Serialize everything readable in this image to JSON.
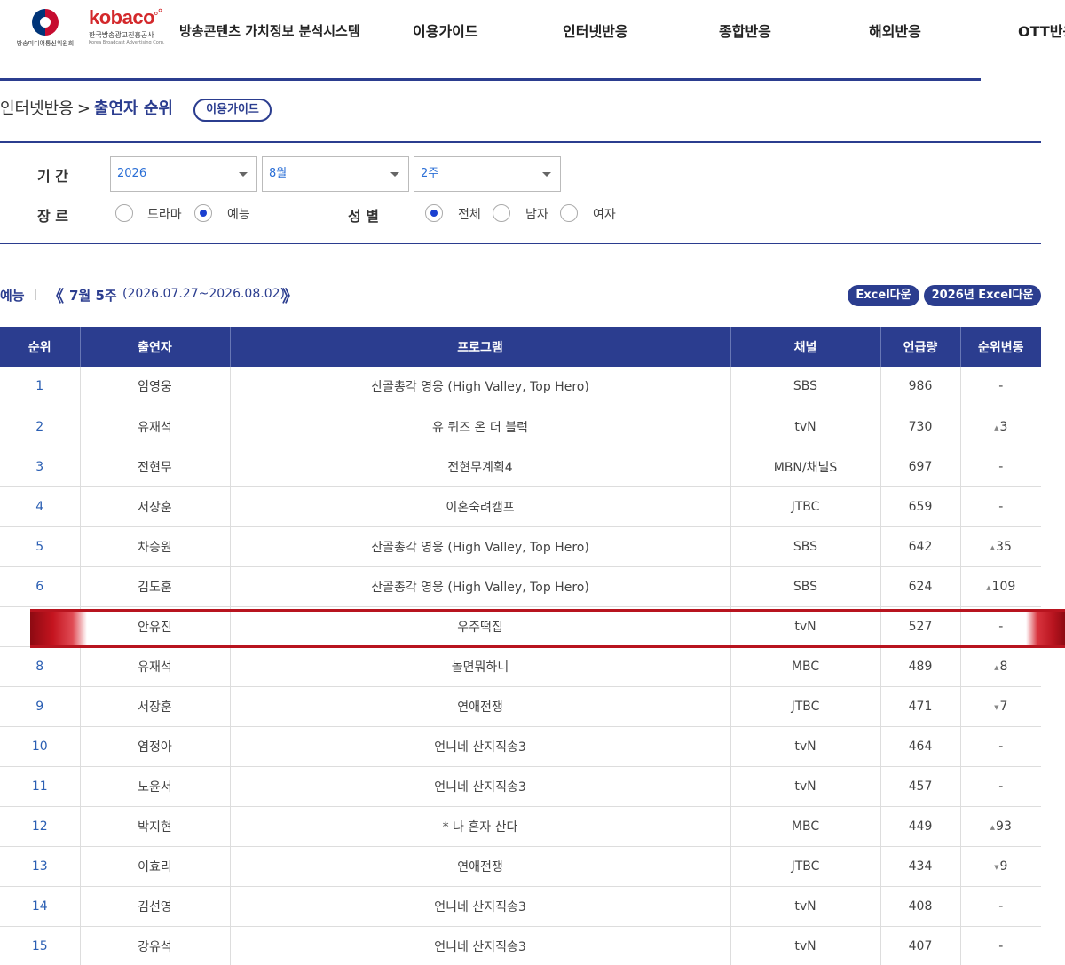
{
  "header": {
    "gov_logo_text": "방송미디어통신위원회",
    "kobaco_word": "kobaco",
    "kobaco_ko": "한국방송광고진흥공사",
    "kobaco_en": "Korea Broadcast Advertising Corp.",
    "site_title": "방송콘텐츠 가치정보 분석시스템",
    "nav": [
      "이용가이드",
      "인터넷반응",
      "종합반응",
      "해외반응",
      "OTT반응"
    ]
  },
  "breadcrumb": {
    "parent": "인터넷반응",
    "separator": ">",
    "current": "출연자 순위",
    "guide_button": "이용가이드"
  },
  "filters": {
    "period_label": "기 간",
    "year": "2026",
    "month": "8월",
    "week": "2주",
    "genre_label": "장 르",
    "genre_options": [
      {
        "label": "드라마",
        "selected": false
      },
      {
        "label": "예능",
        "selected": true
      }
    ],
    "gender_label": "성 별",
    "gender_options": [
      {
        "label": "전체",
        "selected": true
      },
      {
        "label": "남자",
        "selected": false
      },
      {
        "label": "여자",
        "selected": false
      }
    ]
  },
  "week_nav": {
    "genre": "예능",
    "prev_glyph": "《",
    "label": "7월 5주",
    "range": "(2026.07.27~2026.08.02)",
    "next_glyph": "》",
    "excel_button": "Excel다운",
    "excel_year_button": "2026년 Excel다운"
  },
  "table": {
    "columns": [
      "순위",
      "출연자",
      "프로그램",
      "채널",
      "언급량",
      "순위변동"
    ],
    "rows": [
      {
        "rank": "1",
        "name": "임영웅",
        "program": "산골총각 영웅 (High Valley, Top Hero)",
        "channel": "SBS",
        "mentions": "986",
        "change": "-",
        "dir": "none"
      },
      {
        "rank": "2",
        "name": "유재석",
        "program": "유 퀴즈 온 더 블럭",
        "channel": "tvN",
        "mentions": "730",
        "change": "3",
        "dir": "up"
      },
      {
        "rank": "3",
        "name": "전현무",
        "program": "전현무계획4",
        "channel": "MBN/채널S",
        "mentions": "697",
        "change": "-",
        "dir": "none"
      },
      {
        "rank": "4",
        "name": "서장훈",
        "program": "이혼숙려캠프",
        "channel": "JTBC",
        "mentions": "659",
        "change": "-",
        "dir": "none"
      },
      {
        "rank": "5",
        "name": "차승원",
        "program": "산골총각 영웅 (High Valley, Top Hero)",
        "channel": "SBS",
        "mentions": "642",
        "change": "35",
        "dir": "up"
      },
      {
        "rank": "6",
        "name": "김도훈",
        "program": "산골총각 영웅 (High Valley, Top Hero)",
        "channel": "SBS",
        "mentions": "624",
        "change": "109",
        "dir": "up"
      },
      {
        "rank": "",
        "name": "안유진",
        "program": "우주떡집",
        "channel": "tvN",
        "mentions": "527",
        "change": "-",
        "dir": "none"
      },
      {
        "rank": "8",
        "name": "유재석",
        "program": "놀면뭐하니",
        "channel": "MBC",
        "mentions": "489",
        "change": "8",
        "dir": "up"
      },
      {
        "rank": "9",
        "name": "서장훈",
        "program": "연애전쟁",
        "channel": "JTBC",
        "mentions": "471",
        "change": "7",
        "dir": "down"
      },
      {
        "rank": "10",
        "name": "염정아",
        "program": "언니네 산지직송3",
        "channel": "tvN",
        "mentions": "464",
        "change": "-",
        "dir": "none"
      },
      {
        "rank": "11",
        "name": "노윤서",
        "program": "언니네 산지직송3",
        "channel": "tvN",
        "mentions": "457",
        "change": "-",
        "dir": "none"
      },
      {
        "rank": "12",
        "name": "박지현",
        "program": "* 나 혼자 산다",
        "channel": "MBC",
        "mentions": "449",
        "change": "93",
        "dir": "up"
      },
      {
        "rank": "13",
        "name": "이효리",
        "program": "연애전쟁",
        "channel": "JTBC",
        "mentions": "434",
        "change": "9",
        "dir": "down"
      },
      {
        "rank": "14",
        "name": "김선영",
        "program": "언니네 산지직송3",
        "channel": "tvN",
        "mentions": "408",
        "change": "-",
        "dir": "none"
      },
      {
        "rank": "15",
        "name": "강유석",
        "program": "언니네 산지직송3",
        "channel": "tvN",
        "mentions": "407",
        "change": "-",
        "dir": "none"
      }
    ]
  },
  "colors": {
    "brand_navy": "#2b3d8f",
    "kobaco_red": "#d3282b",
    "highlight_red": "#b8141f",
    "radio_blue": "#1a40d0"
  }
}
